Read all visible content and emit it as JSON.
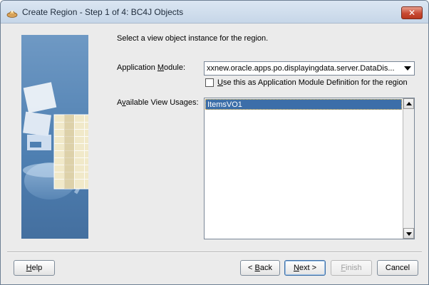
{
  "window": {
    "title": "Create Region - Step 1 of 4: BC4J Objects",
    "close_icon": "close-icon"
  },
  "main": {
    "instruction": "Select a view object instance for the region.",
    "application_module": {
      "label_prefix": "Application ",
      "label_mnemonic": "M",
      "label_suffix": "odule:",
      "value": "xxnew.oracle.apps.po.displayingdata.server.DataDis..."
    },
    "checkbox": {
      "mnemonic": "U",
      "label": "se this as Application Module Definition for the region",
      "checked": false
    },
    "available_view_usages": {
      "label_prefix": "A",
      "label_mnemonic": "v",
      "label_suffix": "ailable View Usages:",
      "items": [
        "ItemsVO1"
      ],
      "selected_index": 0
    }
  },
  "buttons": {
    "help": {
      "mnemonic": "H",
      "rest": "elp"
    },
    "back": {
      "prefix": "< ",
      "mnemonic": "B",
      "rest": "ack"
    },
    "next": {
      "mnemonic": "N",
      "rest": "ext >"
    },
    "finish": {
      "mnemonic": "F",
      "rest": "inish",
      "enabled": false
    },
    "cancel": {
      "label": "Cancel"
    }
  },
  "colors": {
    "selection": "#3c6ea9",
    "title_bar": "#c6d6e8",
    "close_button": "#c84a33"
  }
}
